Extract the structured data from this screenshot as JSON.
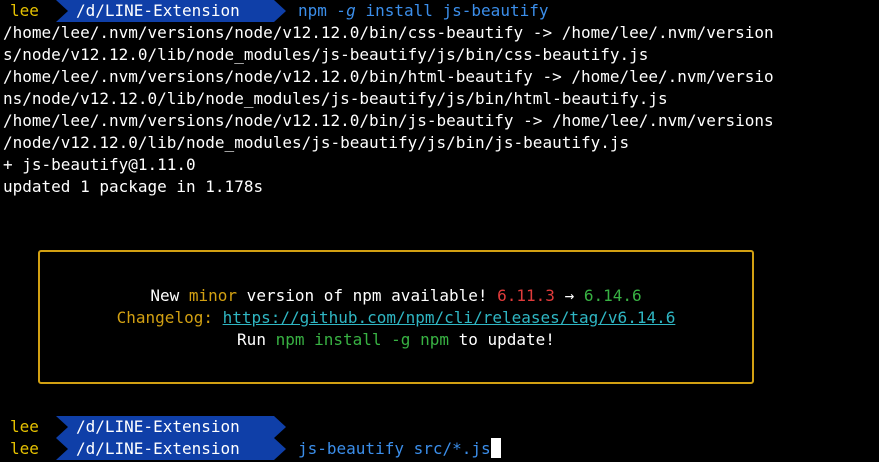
{
  "theme": {
    "background": "#000000",
    "foreground": "#ffffff",
    "prompt_user_color": "#e5c100",
    "prompt_dir_bg": "#0f3fa8",
    "command_color": "#3b8eea",
    "box_border": "#d2a012",
    "old_version_color": "#e03b3b",
    "new_version_color": "#38b243",
    "link_color": "#2fb6c3"
  },
  "prompt1": {
    "user": "lee",
    "dir": "/d/LINE-Extension",
    "cmd_name": "npm",
    "cmd_flag": "-g",
    "cmd_args": "install js-beautify"
  },
  "output": [
    "/home/lee/.nvm/versions/node/v12.12.0/bin/css-beautify -> /home/lee/.nvm/version",
    "s/node/v12.12.0/lib/node_modules/js-beautify/js/bin/css-beautify.js",
    "/home/lee/.nvm/versions/node/v12.12.0/bin/html-beautify -> /home/lee/.nvm/versio",
    "ns/node/v12.12.0/lib/node_modules/js-beautify/js/bin/html-beautify.js",
    "/home/lee/.nvm/versions/node/v12.12.0/bin/js-beautify -> /home/lee/.nvm/versions",
    "/node/v12.12.0/lib/node_modules/js-beautify/js/bin/js-beautify.js",
    "+ js-beautify@1.11.0",
    "updated 1 package in 1.178s"
  ],
  "notice": {
    "line1_prefix": "New ",
    "line1_kind": "minor",
    "line1_mid": " version of npm available! ",
    "old_version": "6.11.3",
    "arrow": " → ",
    "new_version": "6.14.6",
    "changelog_label": "Changelog: ",
    "changelog_url": "https://github.com/npm/cli/releases/tag/v6.14.6",
    "run_prefix": "Run ",
    "run_cmd": "npm install -g npm",
    "run_suffix": " to update!"
  },
  "prompt2": {
    "user": "lee",
    "dir": "/d/LINE-Extension"
  },
  "prompt3": {
    "user": "lee",
    "dir": "/d/LINE-Extension",
    "cmd_name": "js-beautify",
    "cmd_args": "src/*.js"
  }
}
